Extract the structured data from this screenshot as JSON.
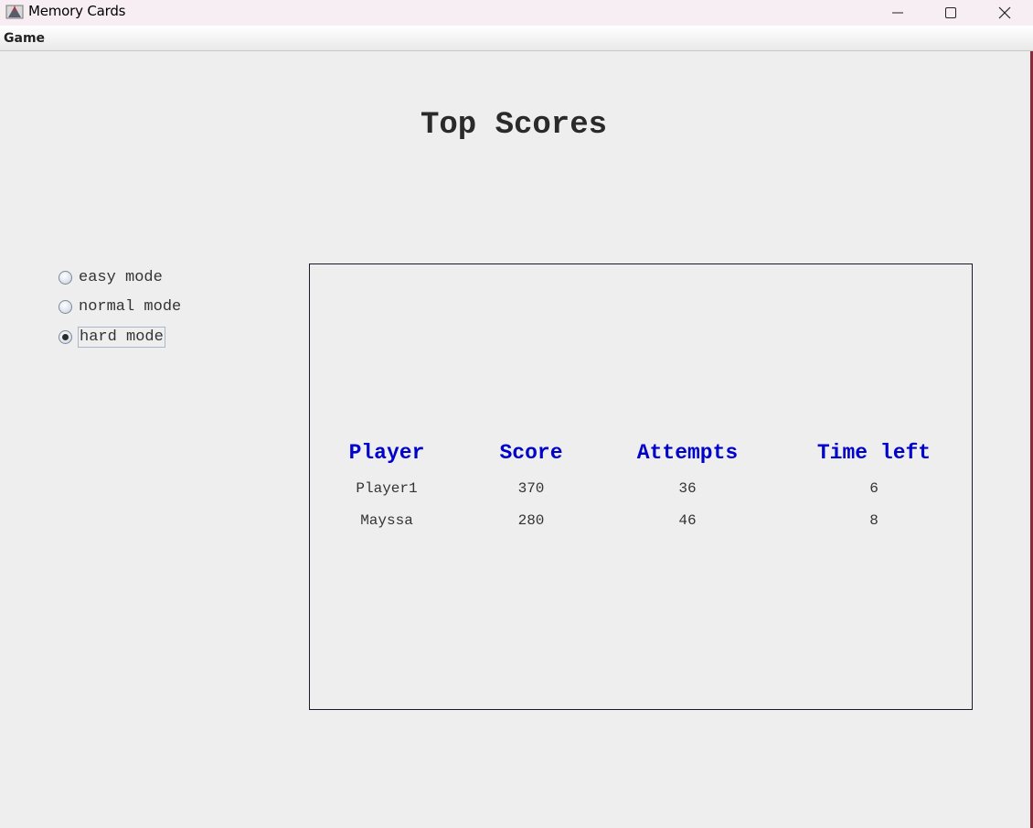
{
  "window": {
    "title": "Memory Cards"
  },
  "menu": {
    "game_label": "Game"
  },
  "page": {
    "title": "Top Scores"
  },
  "modes": [
    {
      "label": "easy mode",
      "selected": false
    },
    {
      "label": "normal mode",
      "selected": false
    },
    {
      "label": "hard mode",
      "selected": true
    }
  ],
  "scores": {
    "headers": [
      "Player",
      "Score",
      "Attempts",
      "Time left"
    ],
    "rows": [
      [
        "Player1",
        "370",
        "36",
        "6"
      ],
      [
        "Mayssa",
        "280",
        "46",
        "8"
      ]
    ]
  },
  "colors": {
    "header_text": "#0000cc",
    "background": "#eeeeee"
  }
}
